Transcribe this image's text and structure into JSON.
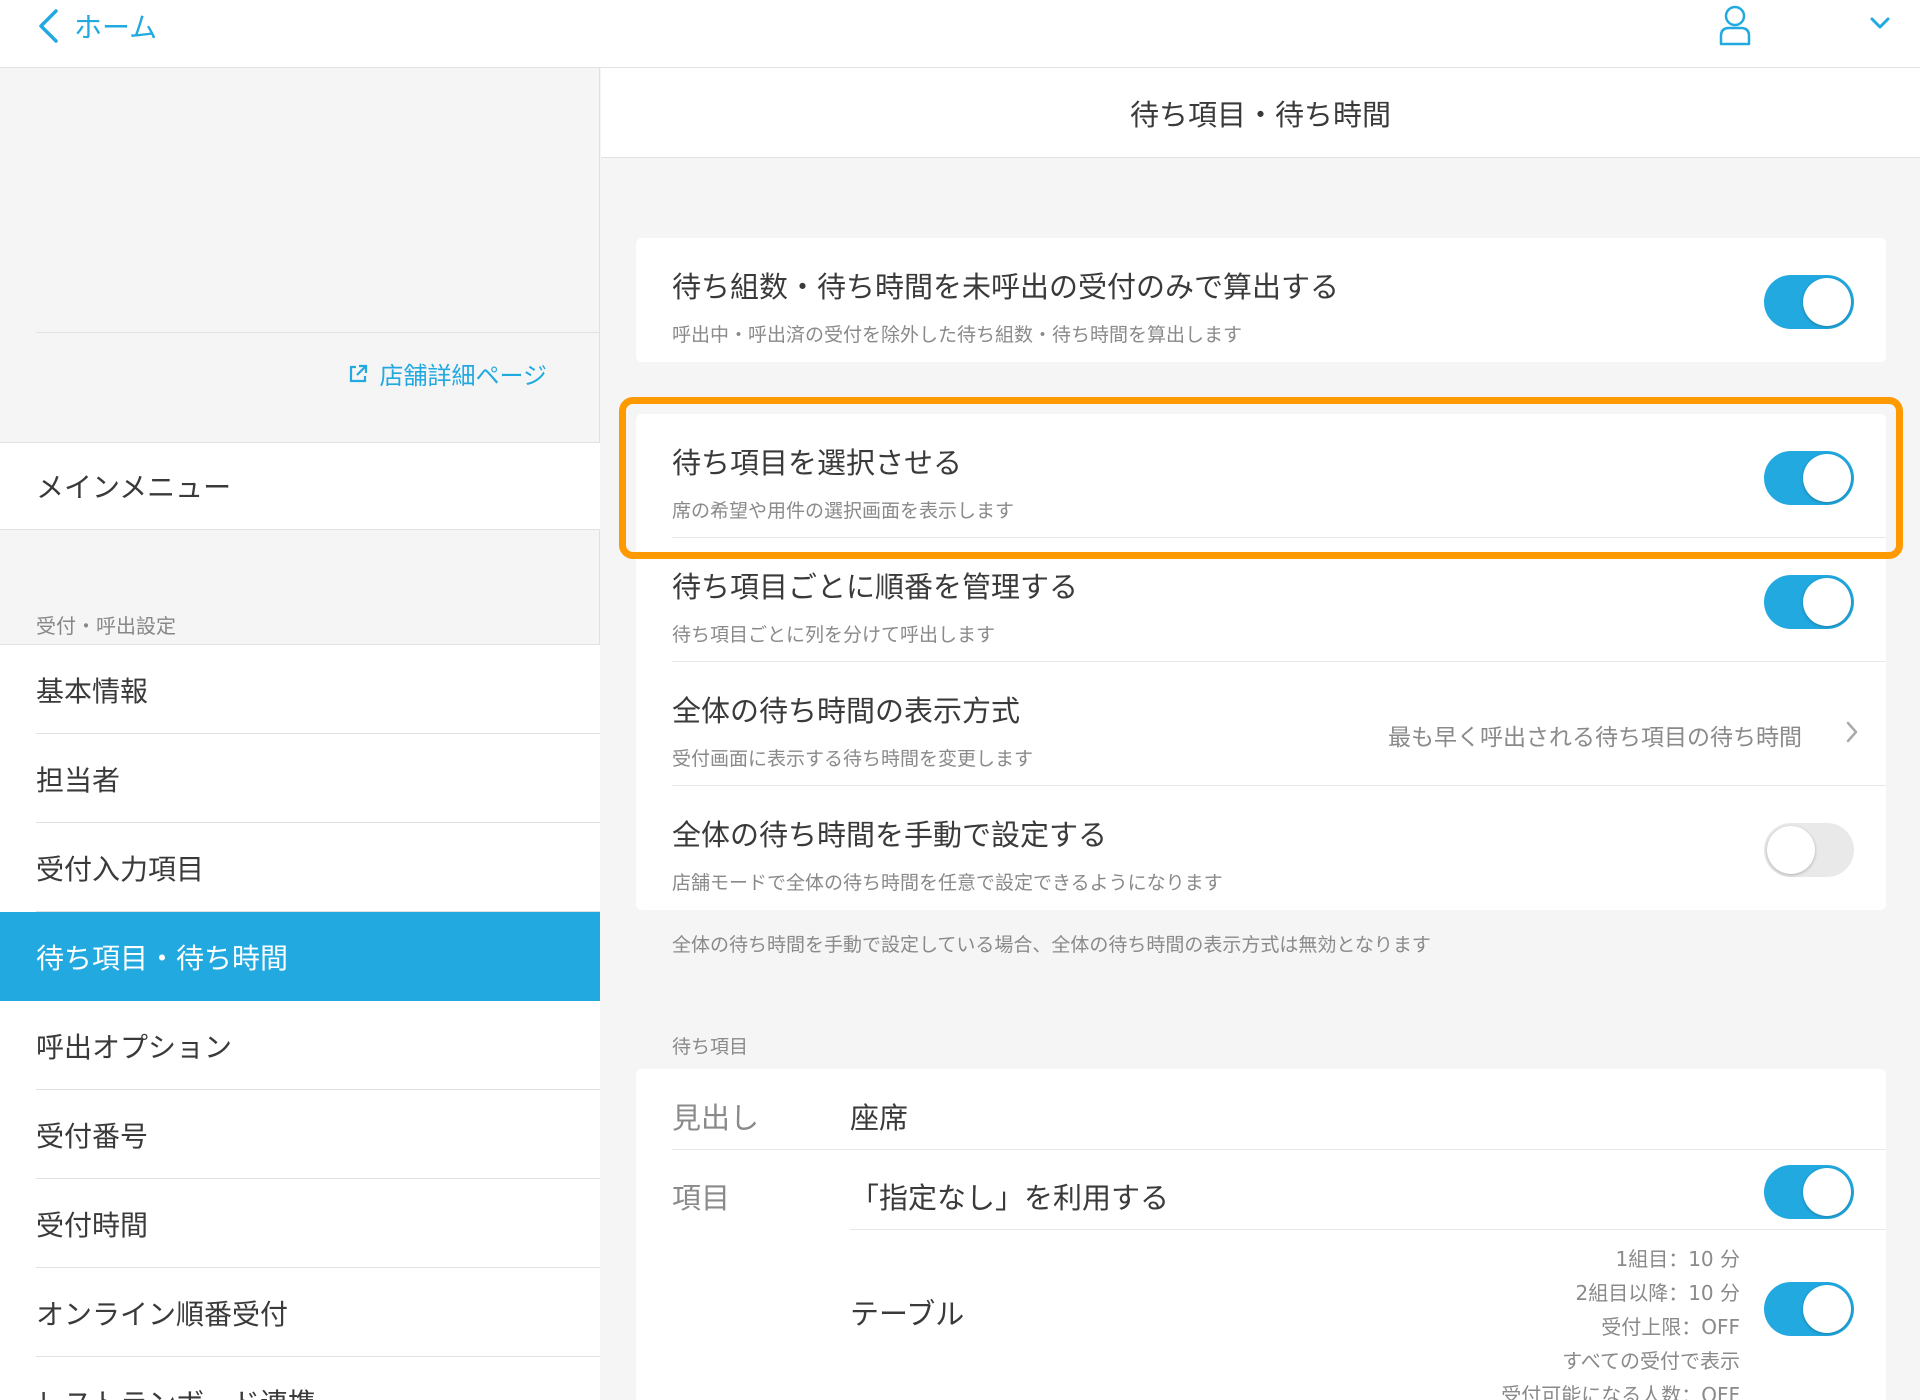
{
  "topbar": {
    "back_label": "ホーム"
  },
  "sidebar": {
    "store_link": "店舗詳細ページ",
    "main_menu": "メインメニュー",
    "section_title": "受付・呼出設定",
    "items": [
      {
        "label": "基本情報"
      },
      {
        "label": "担当者"
      },
      {
        "label": "受付入力項目"
      },
      {
        "label": "待ち項目・待ち時間",
        "active": true
      },
      {
        "label": "呼出オプション"
      },
      {
        "label": "受付番号"
      },
      {
        "label": "受付時間"
      },
      {
        "label": "オンライン順番受付"
      },
      {
        "label": "レストランボード連携"
      }
    ]
  },
  "main": {
    "title": "待ち項目・待ち時間",
    "setting_1": {
      "title": "待ち組数・待ち時間を未呼出の受付のみで算出する",
      "subtitle": "呼出中・呼出済の受付を除外した待ち組数・待ち時間を算出します",
      "enabled": true
    },
    "setting_2": {
      "title": "待ち項目を選択させる",
      "subtitle": "席の希望や用件の選択画面を表示します",
      "enabled": true
    },
    "setting_3": {
      "title": "待ち項目ごとに順番を管理する",
      "subtitle": "待ち項目ごとに列を分けて呼出します",
      "enabled": true
    },
    "setting_4": {
      "title": "全体の待ち時間の表示方式",
      "subtitle": "受付画面に表示する待ち時間を変更します",
      "value": "最も早く呼出される待ち項目の待ち時間"
    },
    "setting_5": {
      "title": "全体の待ち時間を手動で設定する",
      "subtitle": "店舗モードで全体の待ち時間を任意で設定できるようになります",
      "enabled": false
    },
    "note": "全体の待ち時間を手動で設定している場合、全体の待ち時間の表示方式は無効となります",
    "wait_section_title": "待ち項目",
    "wait_items": {
      "heading_label": "見出し",
      "heading_value": "座席",
      "items_label": "項目",
      "none_option": "「指定なし」を利用する",
      "none_enabled": true,
      "table_name": "テーブル",
      "table_enabled": true,
      "table_details": [
        "1組目：10 分",
        "2組目以降：10 分",
        "受付上限：OFF",
        "すべての受付で表示",
        "受付可能になる人数：OFF"
      ]
    }
  },
  "colors": {
    "accent": "#21a9e0",
    "highlight": "#ff9900"
  }
}
